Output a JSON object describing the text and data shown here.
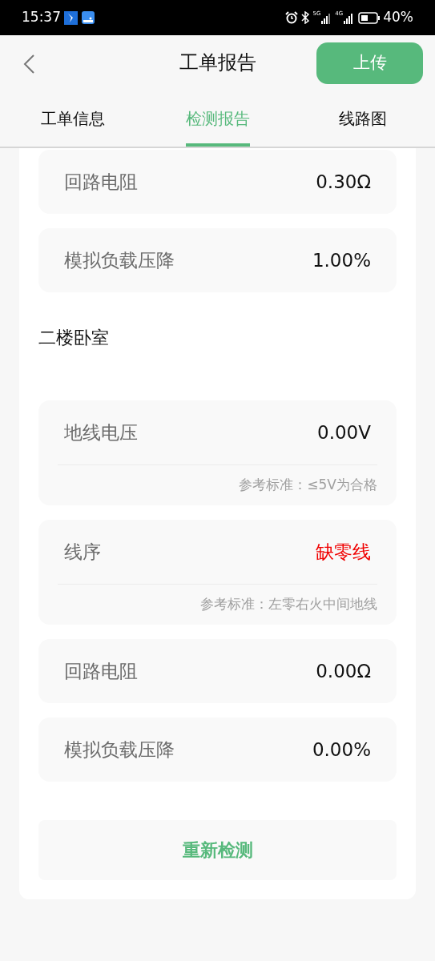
{
  "status_bar": {
    "time": "15:37",
    "network_1": "5G",
    "network_2": "4G",
    "battery": "40%"
  },
  "header": {
    "title": "工单报告",
    "action": "上传"
  },
  "tabs": [
    {
      "label": "工单信息",
      "selected": false
    },
    {
      "label": "检测报告",
      "selected": true
    },
    {
      "label": "线路图",
      "selected": false
    }
  ],
  "rows": [
    {
      "kind": "measure",
      "label": "回路电阻",
      "value": "0.30Ω",
      "abnormal": false
    },
    {
      "kind": "measure",
      "label": "模拟负载压降",
      "value": "1.00%",
      "abnormal": false
    },
    {
      "kind": "section",
      "label": "二楼卧室"
    },
    {
      "kind": "measure",
      "label": "地线电压",
      "value": "0.00V",
      "abnormal": false,
      "note": "参考标准：≤5V为合格"
    },
    {
      "kind": "measure",
      "label": "线序",
      "value": "缺零线",
      "abnormal": true,
      "note": "参考标准：左零右火中间地线"
    },
    {
      "kind": "measure",
      "label": "回路电阻",
      "value": "0.00Ω",
      "abnormal": false
    },
    {
      "kind": "measure",
      "label": "模拟负载压降",
      "value": "0.00%",
      "abnormal": false
    }
  ],
  "retest_button": "重新检测"
}
